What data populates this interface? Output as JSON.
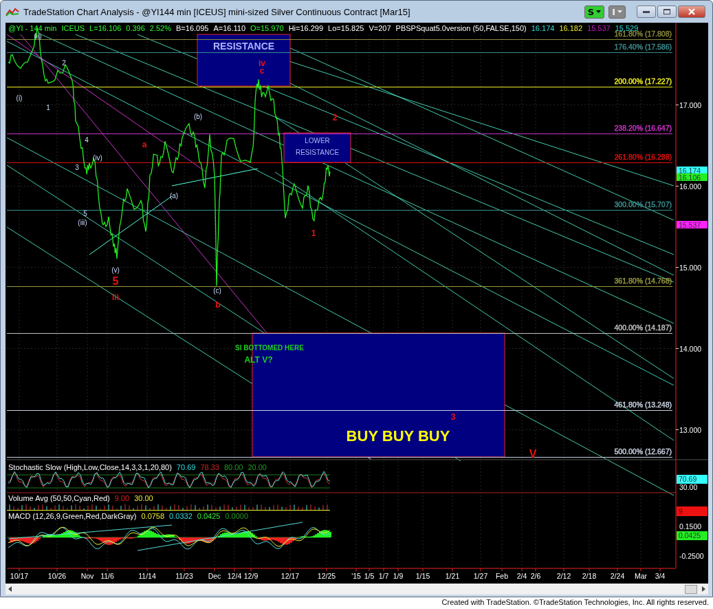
{
  "window": {
    "title": "TradeStation Chart Analysis - @YI144 min [ICEUS] mini-sized Silver Continuous Contract [Mar15]",
    "toolbar": [
      "S",
      "I"
    ]
  },
  "chart": {
    "header": [
      {
        "text": "@YI - 144 min",
        "kind": "quote"
      },
      {
        "text": "ICEUS",
        "kind": "quote"
      },
      {
        "text": "L=16.106",
        "kind": "quote"
      },
      {
        "text": "0.396",
        "kind": "quote"
      },
      {
        "text": "2.52%",
        "kind": "quote"
      },
      {
        "text": "B=16.095",
        "kind": "info"
      },
      {
        "text": "A=16.110",
        "kind": "info"
      },
      {
        "text": "O=15.970",
        "kind": "quote"
      },
      {
        "text": "Hi=16.299",
        "kind": "info"
      },
      {
        "text": "Lo=15.825",
        "kind": "info"
      },
      {
        "text": "V=207",
        "kind": "info"
      },
      {
        "text": "PBSPSquat5.0version (50,FALSE,150)",
        "kind": "info"
      },
      {
        "text": "16.174",
        "kind": "plot_fast"
      },
      {
        "text": "16.182",
        "kind": "plot_slow"
      },
      {
        "text": "15.537",
        "kind": "plot_low"
      },
      {
        "text": "15.529",
        "kind": "plot_fast"
      }
    ],
    "fib_levels": [
      {
        "label": "161.80% (17.808)",
        "color": "#8c8a3c"
      },
      {
        "label": "176.40% (17.586)",
        "color": "#3c8c8c"
      },
      {
        "label": "200.00% (17.227)",
        "color": "#eeee22"
      },
      {
        "label": "238.20% (16.647)",
        "color": "#cc33cc"
      },
      {
        "label": "261.80% (16.288)",
        "color": "#dd1111"
      },
      {
        "label": "300.00% (15.707)",
        "color": "#3a8f8f"
      },
      {
        "label": "361.80% (14.768)",
        "color": "#9a9a40"
      },
      {
        "label": "400.00% (14.187)",
        "color": "#c0c0c0"
      },
      {
        "label": "461.80% (13.248)",
        "color": "#c8d0e0"
      },
      {
        "label": "500.00% (12.667)",
        "color": "#c8d0e0"
      }
    ],
    "zones": [
      {
        "lines": [
          "RESISTANCE"
        ]
      },
      {
        "lines": [
          "LOWER",
          "RESISTANCE"
        ]
      }
    ],
    "annotations": [
      {
        "text": "(ii)",
        "kind": "wave"
      },
      {
        "text": "2",
        "kind": "wave"
      },
      {
        "text": "(i)",
        "kind": "wave"
      },
      {
        "text": "1",
        "kind": "wave"
      },
      {
        "text": "4",
        "kind": "wave"
      },
      {
        "text": "3",
        "kind": "wave"
      },
      {
        "text": "(iv)",
        "kind": "wave"
      },
      {
        "text": "5",
        "kind": "wave"
      },
      {
        "text": "(iii)",
        "kind": "wave"
      },
      {
        "text": "(v)",
        "kind": "wave"
      },
      {
        "text": "5",
        "kind": "major_big"
      },
      {
        "text": "iii",
        "kind": "major"
      },
      {
        "text": "a",
        "kind": "major"
      },
      {
        "text": "(b)",
        "kind": "wave"
      },
      {
        "text": "(a)",
        "kind": "wave"
      },
      {
        "text": "(c)",
        "kind": "wave"
      },
      {
        "text": "b",
        "kind": "major"
      },
      {
        "text": "iv",
        "kind": "major"
      },
      {
        "text": "c",
        "kind": "major"
      },
      {
        "text": "2",
        "kind": "major"
      },
      {
        "text": "1",
        "kind": "major"
      },
      {
        "text": "SI BOTTOMED HERE",
        "kind": "note"
      },
      {
        "text": "ALT V?",
        "kind": "note_big"
      },
      {
        "text": "3",
        "kind": "major"
      },
      {
        "text": "BUY BUY BUY",
        "kind": "banner"
      },
      {
        "text": "V",
        "kind": "major_big"
      }
    ],
    "price_axis": [
      "17.000",
      "16.000",
      "15.000",
      "14.000",
      "13.000"
    ],
    "price_markers": [
      {
        "text": "16.174",
        "color": "#33ffff"
      },
      {
        "text": "16.106",
        "color": "#22ee22"
      },
      {
        "text": "15.537",
        "color": "#ff22ff"
      }
    ]
  },
  "stochastic": {
    "title": "Stochastic Slow (High,Low,Close,14,3,3,1,20,80)",
    "values": [
      {
        "text": "70.69",
        "kind": "k"
      },
      {
        "text": "78.33",
        "kind": "d"
      },
      {
        "text": "80.00",
        "kind": "band"
      },
      {
        "text": "20.00",
        "kind": "band"
      }
    ],
    "axis": [
      "30.00"
    ],
    "marker": {
      "text": "70.69",
      "color": "#33ffff"
    }
  },
  "volume": {
    "title": "Volume Avg (50,50,Cyan,Red)",
    "values": [
      {
        "text": "9.00",
        "kind": "avg"
      },
      {
        "text": "30.00",
        "kind": "level"
      }
    ],
    "marker": {
      "text": "9",
      "color": "#ee1111"
    }
  },
  "macd": {
    "title": "MACD (12,26,9,Green,Red,DarkGray)",
    "values": [
      {
        "text": "0.0758",
        "kind": "macd"
      },
      {
        "text": "0.0332",
        "kind": "signal"
      },
      {
        "text": "0.0425",
        "kind": "diff"
      },
      {
        "text": "0.0000",
        "kind": "zero"
      }
    ],
    "axis": [
      "0.1500",
      "-0.2500"
    ],
    "marker": {
      "text": "0.0425",
      "color": "#22ee22"
    }
  },
  "date_axis": [
    "10/17",
    "10/26",
    "Nov",
    "11/6",
    "11/14",
    "11/23",
    "Dec",
    "12/4",
    "12/9",
    "12/17",
    "12/25",
    "'15",
    "1/5",
    "1/7",
    "1/9",
    "1/15",
    "1/21",
    "1/27",
    "Feb",
    "2/4",
    "2/6",
    "2/12",
    "2/18",
    "2/24",
    "Mar",
    "3/4"
  ],
  "footer": "Created with TradeStation. ©TradeStation Technologies, Inc. All rights reserved."
}
